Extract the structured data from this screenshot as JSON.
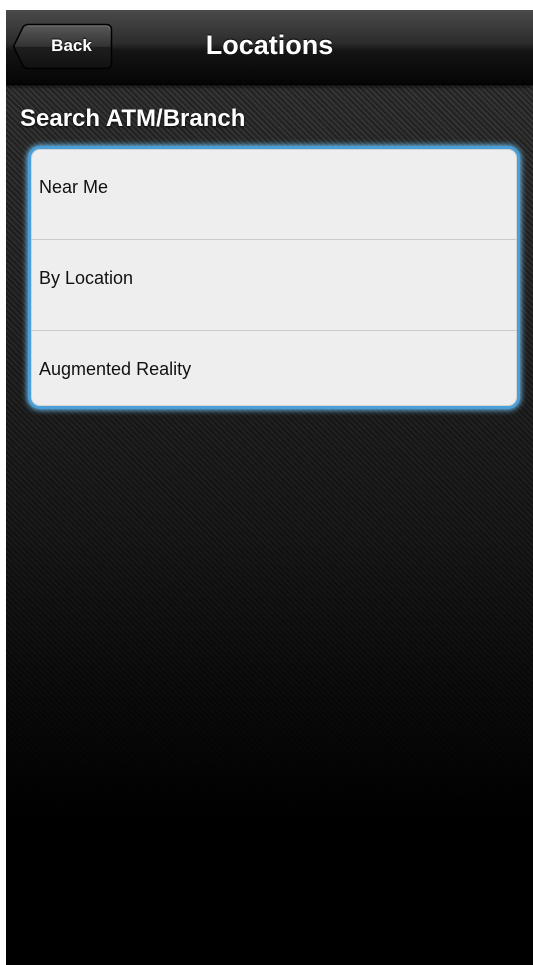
{
  "nav_bar": {
    "title": "Locations",
    "back_label": "Back"
  },
  "section": {
    "header": "Search ATM/Branch"
  },
  "options": [
    {
      "label": "Near Me"
    },
    {
      "label": "By Location"
    },
    {
      "label": "Augmented Reality"
    }
  ],
  "colors": {
    "list_border": "#4a9fd8",
    "list_background": "#eeeeee",
    "nav_bar": "#1a1a1a"
  },
  "icons": {
    "back": "chevron-left-button"
  }
}
